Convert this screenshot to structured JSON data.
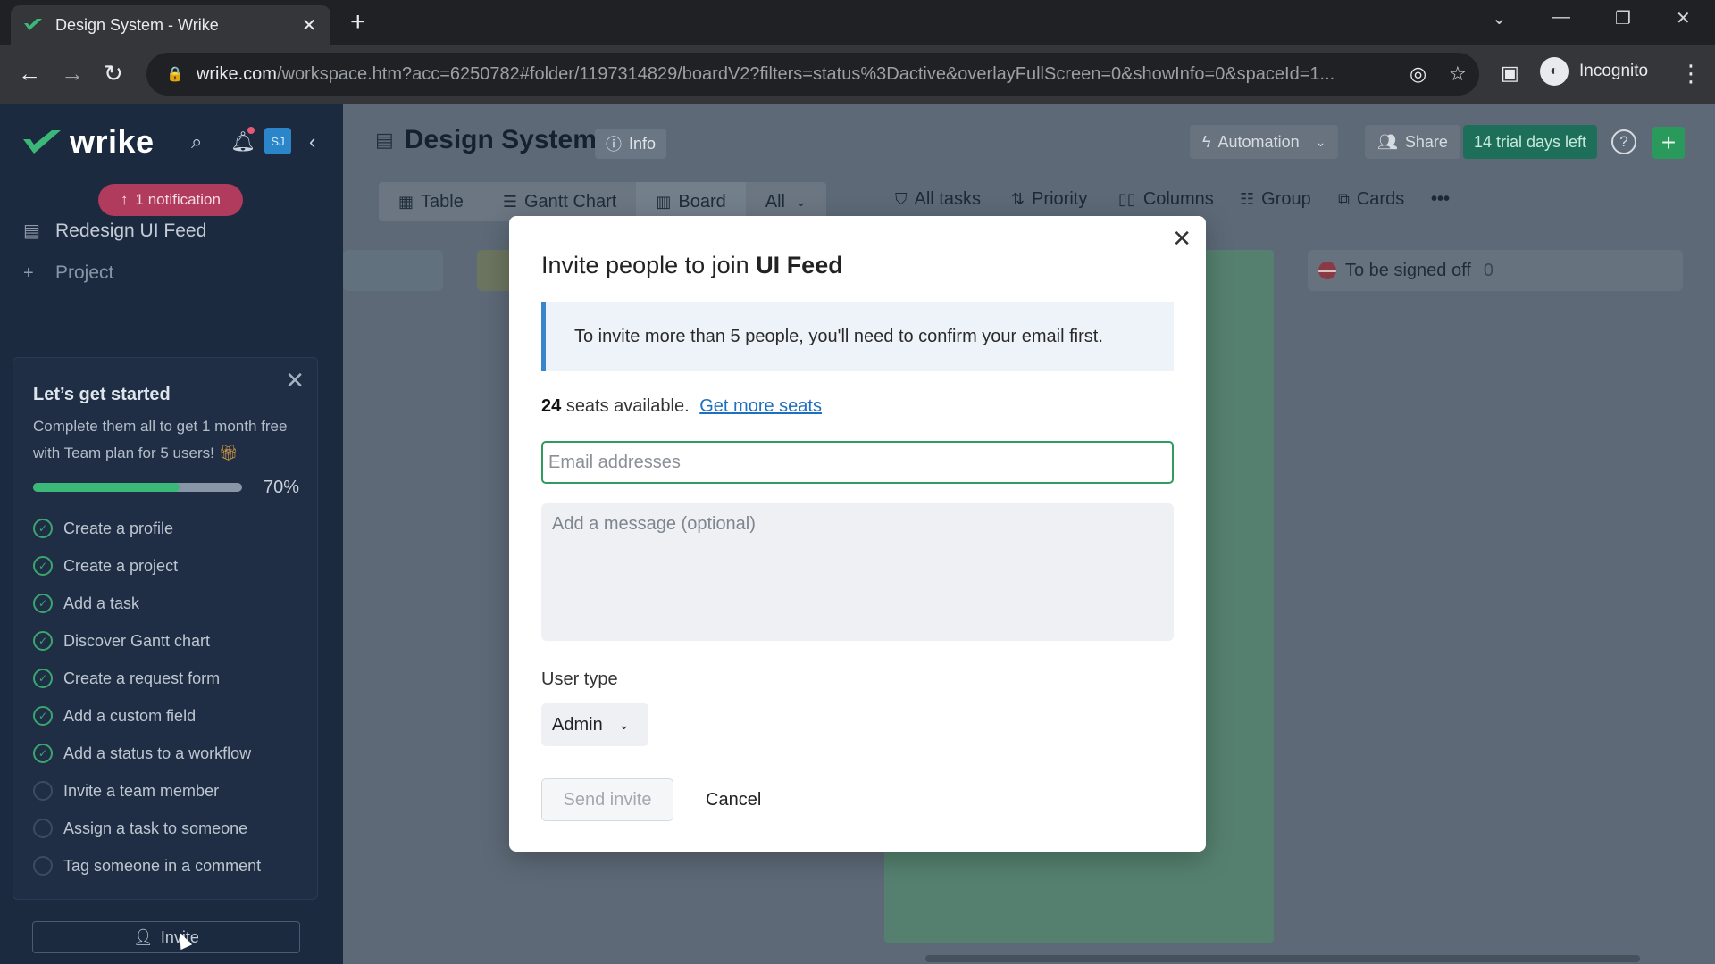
{
  "browser": {
    "tab_title": "Design System - Wrike",
    "url_host": "wrike.com",
    "url_path": "/workspace.htm?acc=6250782#folder/1197314829/boardV2?filters=status%3Dactive&overlayFullScreen=0&showInfo=0&spaceId=1...",
    "profile_label": "Incognito"
  },
  "sidebar": {
    "logo_text": "wrike",
    "avatar_initials": "SJ",
    "notification_label": "1 notification",
    "items": [
      {
        "label": "Redesign UI Feed",
        "icon": "document-icon"
      },
      {
        "label": "Project",
        "icon": "plus-icon"
      }
    ],
    "getting_started": {
      "title": "Let’s get started",
      "subtitle": "Complete them all to get 1 month free with Team plan for 5 users!",
      "progress_percent": 70,
      "progress_label": "70%",
      "tasks": [
        {
          "label": "Create a profile",
          "done": true
        },
        {
          "label": "Create a project",
          "done": true
        },
        {
          "label": "Add a task",
          "done": true
        },
        {
          "label": "Discover Gantt chart",
          "done": true
        },
        {
          "label": "Create a request form",
          "done": true
        },
        {
          "label": "Add a custom field",
          "done": true
        },
        {
          "label": "Add a status to a workflow",
          "done": true
        },
        {
          "label": "Invite a team member",
          "done": false
        },
        {
          "label": "Assign a task to someone",
          "done": false
        },
        {
          "label": "Tag someone in a comment",
          "done": false
        }
      ]
    },
    "invite_label": "Invite"
  },
  "header": {
    "title": "Design System",
    "info_label": "Info",
    "automation_label": "Automation",
    "share_label": "Share",
    "trial_label": "14 trial days left"
  },
  "views": {
    "tabs": [
      {
        "label": "Table",
        "icon": "table-icon"
      },
      {
        "label": "Gantt Chart",
        "icon": "gantt-icon"
      },
      {
        "label": "Board",
        "icon": "board-icon"
      },
      {
        "label": "All",
        "icon": "chevron-down-icon"
      }
    ],
    "tools": [
      {
        "label": "All tasks",
        "icon": "filter-icon"
      },
      {
        "label": "Priority",
        "icon": "sort-icon"
      },
      {
        "label": "Columns",
        "icon": "columns-icon"
      },
      {
        "label": "Group",
        "icon": "group-icon"
      },
      {
        "label": "Cards",
        "icon": "cards-icon"
      }
    ]
  },
  "board": {
    "column_label": "To be signed off",
    "column_count": "0"
  },
  "modal": {
    "title_prefix": "Invite people to join",
    "title_target": "UI Feed",
    "info_text": "To invite more than 5 people, you'll need to confirm your email first.",
    "seats_count": "24",
    "seats_text": "seats available.",
    "get_more_seats": "Get more seats",
    "email_placeholder": "Email addresses",
    "email_value": "",
    "message_placeholder": "Add a message (optional)",
    "user_type_label": "User type",
    "user_type_value": "Admin",
    "send_label": "Send invite",
    "cancel_label": "Cancel"
  },
  "colors": {
    "accent_green": "#2f9b5e",
    "link_blue": "#1f6fc0",
    "info_border": "#3a84cc"
  }
}
